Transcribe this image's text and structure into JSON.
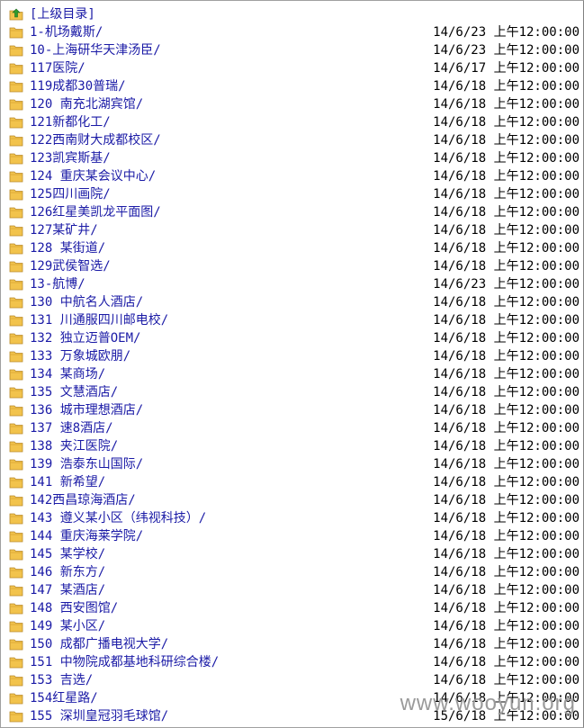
{
  "parent": {
    "label": "[上级目录]",
    "icon": "folder-up-icon"
  },
  "entries": [
    {
      "name": "1-机场戴斯/",
      "date": "14/6/23 上午12:00:00"
    },
    {
      "name": "10-上海研华天津汤臣/",
      "date": "14/6/23 上午12:00:00"
    },
    {
      "name": "117医院/",
      "date": "14/6/17 上午12:00:00"
    },
    {
      "name": "119成都30普瑞/",
      "date": "14/6/18 上午12:00:00"
    },
    {
      "name": "120 南充北湖宾馆/",
      "date": "14/6/18 上午12:00:00"
    },
    {
      "name": "121新都化工/",
      "date": "14/6/18 上午12:00:00"
    },
    {
      "name": "122西南财大成都校区/",
      "date": "14/6/18 上午12:00:00"
    },
    {
      "name": "123凯宾斯基/",
      "date": "14/6/18 上午12:00:00"
    },
    {
      "name": "124 重庆某会议中心/",
      "date": "14/6/18 上午12:00:00"
    },
    {
      "name": "125四川画院/",
      "date": "14/6/18 上午12:00:00"
    },
    {
      "name": "126红星美凯龙平面图/",
      "date": "14/6/18 上午12:00:00"
    },
    {
      "name": "127某矿井/",
      "date": "14/6/18 上午12:00:00"
    },
    {
      "name": "128 某街道/",
      "date": "14/6/18 上午12:00:00"
    },
    {
      "name": "129武侯智选/",
      "date": "14/6/18 上午12:00:00"
    },
    {
      "name": "13-航博/",
      "date": "14/6/23 上午12:00:00"
    },
    {
      "name": "130 中航名人酒店/",
      "date": "14/6/18 上午12:00:00"
    },
    {
      "name": "131 川通服四川邮电校/",
      "date": "14/6/18 上午12:00:00"
    },
    {
      "name": "132 独立迈普OEM/",
      "date": "14/6/18 上午12:00:00"
    },
    {
      "name": "133 万象城欧朋/",
      "date": "14/6/18 上午12:00:00"
    },
    {
      "name": "134 某商场/",
      "date": "14/6/18 上午12:00:00"
    },
    {
      "name": "135 文慧酒店/",
      "date": "14/6/18 上午12:00:00"
    },
    {
      "name": "136 城市理想酒店/",
      "date": "14/6/18 上午12:00:00"
    },
    {
      "name": "137 速8酒店/",
      "date": "14/6/18 上午12:00:00"
    },
    {
      "name": "138 夹江医院/",
      "date": "14/6/18 上午12:00:00"
    },
    {
      "name": "139 浩泰东山国际/",
      "date": "14/6/18 上午12:00:00"
    },
    {
      "name": "141 新希望/",
      "date": "14/6/18 上午12:00:00"
    },
    {
      "name": "142西昌琼海酒店/",
      "date": "14/6/18 上午12:00:00"
    },
    {
      "name": "143 遵义某小区（纬视科技）/",
      "date": "14/6/18 上午12:00:00"
    },
    {
      "name": "144 重庆海莱学院/",
      "date": "14/6/18 上午12:00:00"
    },
    {
      "name": "145 某学校/",
      "date": "14/6/18 上午12:00:00"
    },
    {
      "name": "146 新东方/",
      "date": "14/6/18 上午12:00:00"
    },
    {
      "name": "147 某酒店/",
      "date": "14/6/18 上午12:00:00"
    },
    {
      "name": "148 西安图馆/",
      "date": "14/6/18 上午12:00:00"
    },
    {
      "name": "149 某小区/",
      "date": "14/6/18 上午12:00:00"
    },
    {
      "name": "150 成都广播电视大学/",
      "date": "14/6/18 上午12:00:00"
    },
    {
      "name": "151 中物院成都基地科研综合楼/",
      "date": "14/6/18 上午12:00:00"
    },
    {
      "name": "153 吉选/",
      "date": "14/6/18 上午12:00:00"
    },
    {
      "name": "154红星路/",
      "date": "14/6/18 上午12:00:00"
    },
    {
      "name": "155 深圳皇冠羽毛球馆/",
      "date": "15/6/18 上午12:00:00"
    }
  ],
  "watermark": "www.wooyun.org",
  "colors": {
    "link": "#1a1aa6",
    "folder": "#f2c34c",
    "up_arrow": "#2e9b2e"
  }
}
